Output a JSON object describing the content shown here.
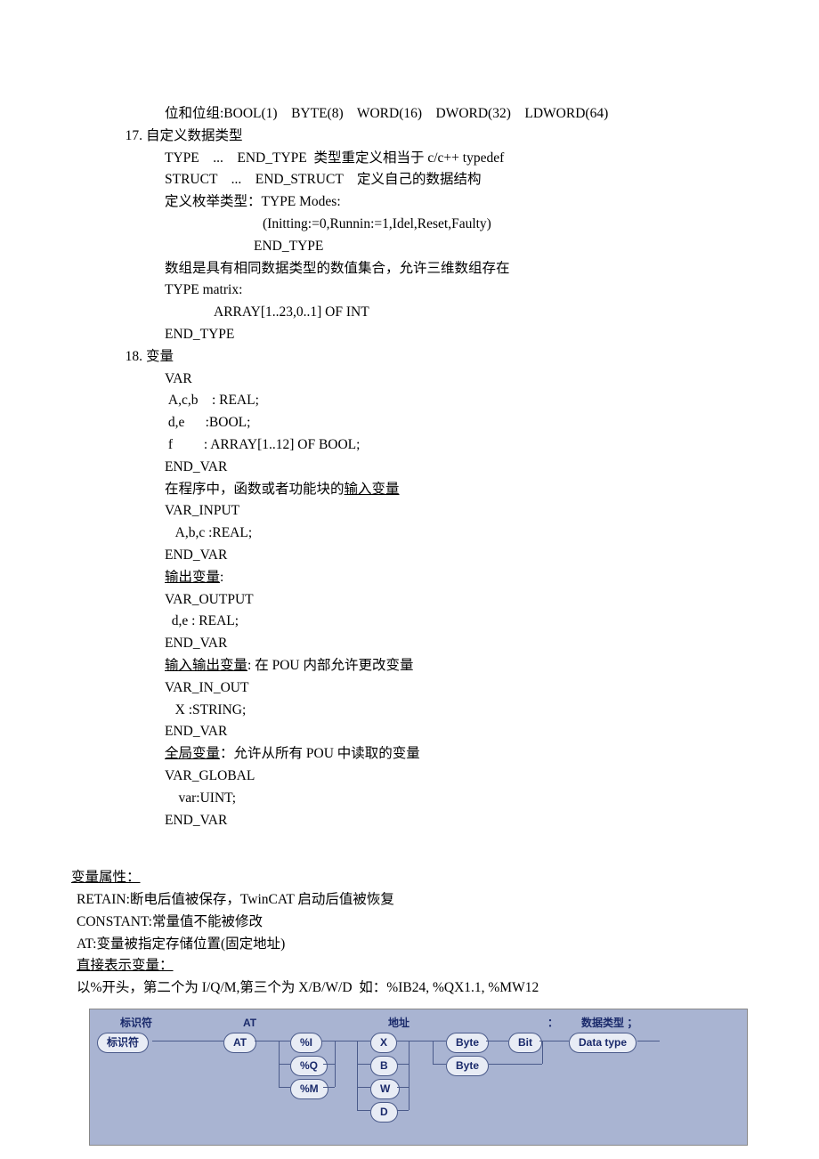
{
  "lines": {
    "l1": "位和位组:BOOL(1)    BYTE(8)    WORD(16)    DWORD(32)    LDWORD(64)",
    "n17": "17.",
    "t17": "自定义数据类型",
    "l2": "TYPE    ...    END_TYPE  类型重定义相当于 c/c++ typedef",
    "l3": "STRUCT    ...    END_STRUCT    定义自己的数据结构",
    "l4": "定义枚举类型：TYPE Modes:",
    "l5": "(Initting:=0,Runnin:=1,Idel,Reset,Faulty)",
    "l6": "END_TYPE",
    "l7": "数组是具有相同数据类型的数值集合，允许三维数组存在",
    "l8": "TYPE matrix:",
    "l9": "ARRAY[1..23,0..1] OF INT",
    "l10": "END_TYPE",
    "n18": "18.",
    "t18": "变量",
    "l11": "VAR",
    "l12": " A,c,b    : REAL;",
    "l13": " d,e      :BOOL;",
    "l14": " f         : ARRAY[1..12] OF BOOL;",
    "l15": "END_VAR",
    "l16a": "在程序中，函数或者功能块的",
    "l16b": "输入变量",
    "l17": "VAR_INPUT",
    "l18": "   A,b,c :REAL;",
    "l19": "END_VAR",
    "l20": "输出变量",
    "l20b": ":",
    "l21": "VAR_OUTPUT",
    "l22": "  d,e : REAL;",
    "l23": "END_VAR",
    "l24": "输入输出变量",
    "l24b": ": 在 POU 内部允许更改变量",
    "l25": "VAR_IN_OUT",
    "l26": "   X :STRING;",
    "l27": "END_VAR",
    "l28": "全局变量",
    "l28b": "：允许从所有 POU 中读取的变量",
    "l29": "VAR_GLOBAL",
    "l30": "    var:UINT;",
    "l31": "END_VAR",
    "l32": "变量属性：",
    "l33": "RETAIN:断电后值被保存，TwinCAT 启动后值被恢复",
    "l34": "CONSTANT:常量值不能被修改",
    "l35": "AT:变量被指定存储位置(固定地址)",
    "l36": "直接表示变量：",
    "l37": "以%开头，第二个为 I/Q/M,第三个为 X/B/W/D  如：%IB24, %QX1.1, %MW12"
  },
  "diagram": {
    "h1": "标识符",
    "h2": "AT",
    "h3": "地址",
    "h4": "：",
    "h5": "数据类型 ；",
    "p_ident": "标识符",
    "p_at": "AT",
    "p_i": "%I",
    "p_q": "%Q",
    "p_m": "%M",
    "p_x": "X",
    "p_b": "B",
    "p_w": "W",
    "p_d": "D",
    "p_byte1": "Byte",
    "p_bit": "Bit",
    "p_byte2": "Byte",
    "p_dt": "Data type"
  }
}
